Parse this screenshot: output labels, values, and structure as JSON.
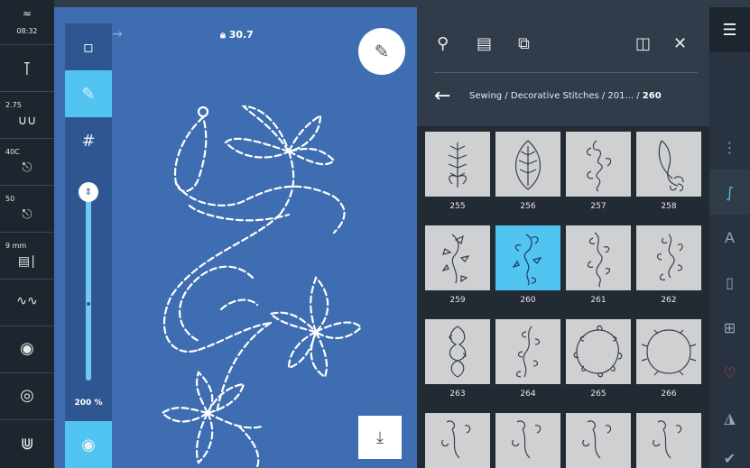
{
  "status": {
    "time": "08:32",
    "stitch_width": "2.75",
    "tension": "40C",
    "presser": "50",
    "needle": "9 mm"
  },
  "canvas": {
    "lock_value": "30.7",
    "zoom_label": "200 %"
  },
  "panel": {
    "breadcrumb_path": "Sewing / Decorative Stitches / 201... / ",
    "breadcrumb_current": "260"
  },
  "stitches": [
    {
      "number": "255",
      "selected": false
    },
    {
      "number": "256",
      "selected": false
    },
    {
      "number": "257",
      "selected": false
    },
    {
      "number": "258",
      "selected": false
    },
    {
      "number": "259",
      "selected": false
    },
    {
      "number": "260",
      "selected": true
    },
    {
      "number": "261",
      "selected": false
    },
    {
      "number": "262",
      "selected": false
    },
    {
      "number": "263",
      "selected": false
    },
    {
      "number": "264",
      "selected": false
    },
    {
      "number": "265",
      "selected": false
    },
    {
      "number": "266",
      "selected": false
    }
  ],
  "colors": {
    "accent": "#52c4f2",
    "canvas": "#3e6eb1",
    "panel": "#313c4a"
  }
}
